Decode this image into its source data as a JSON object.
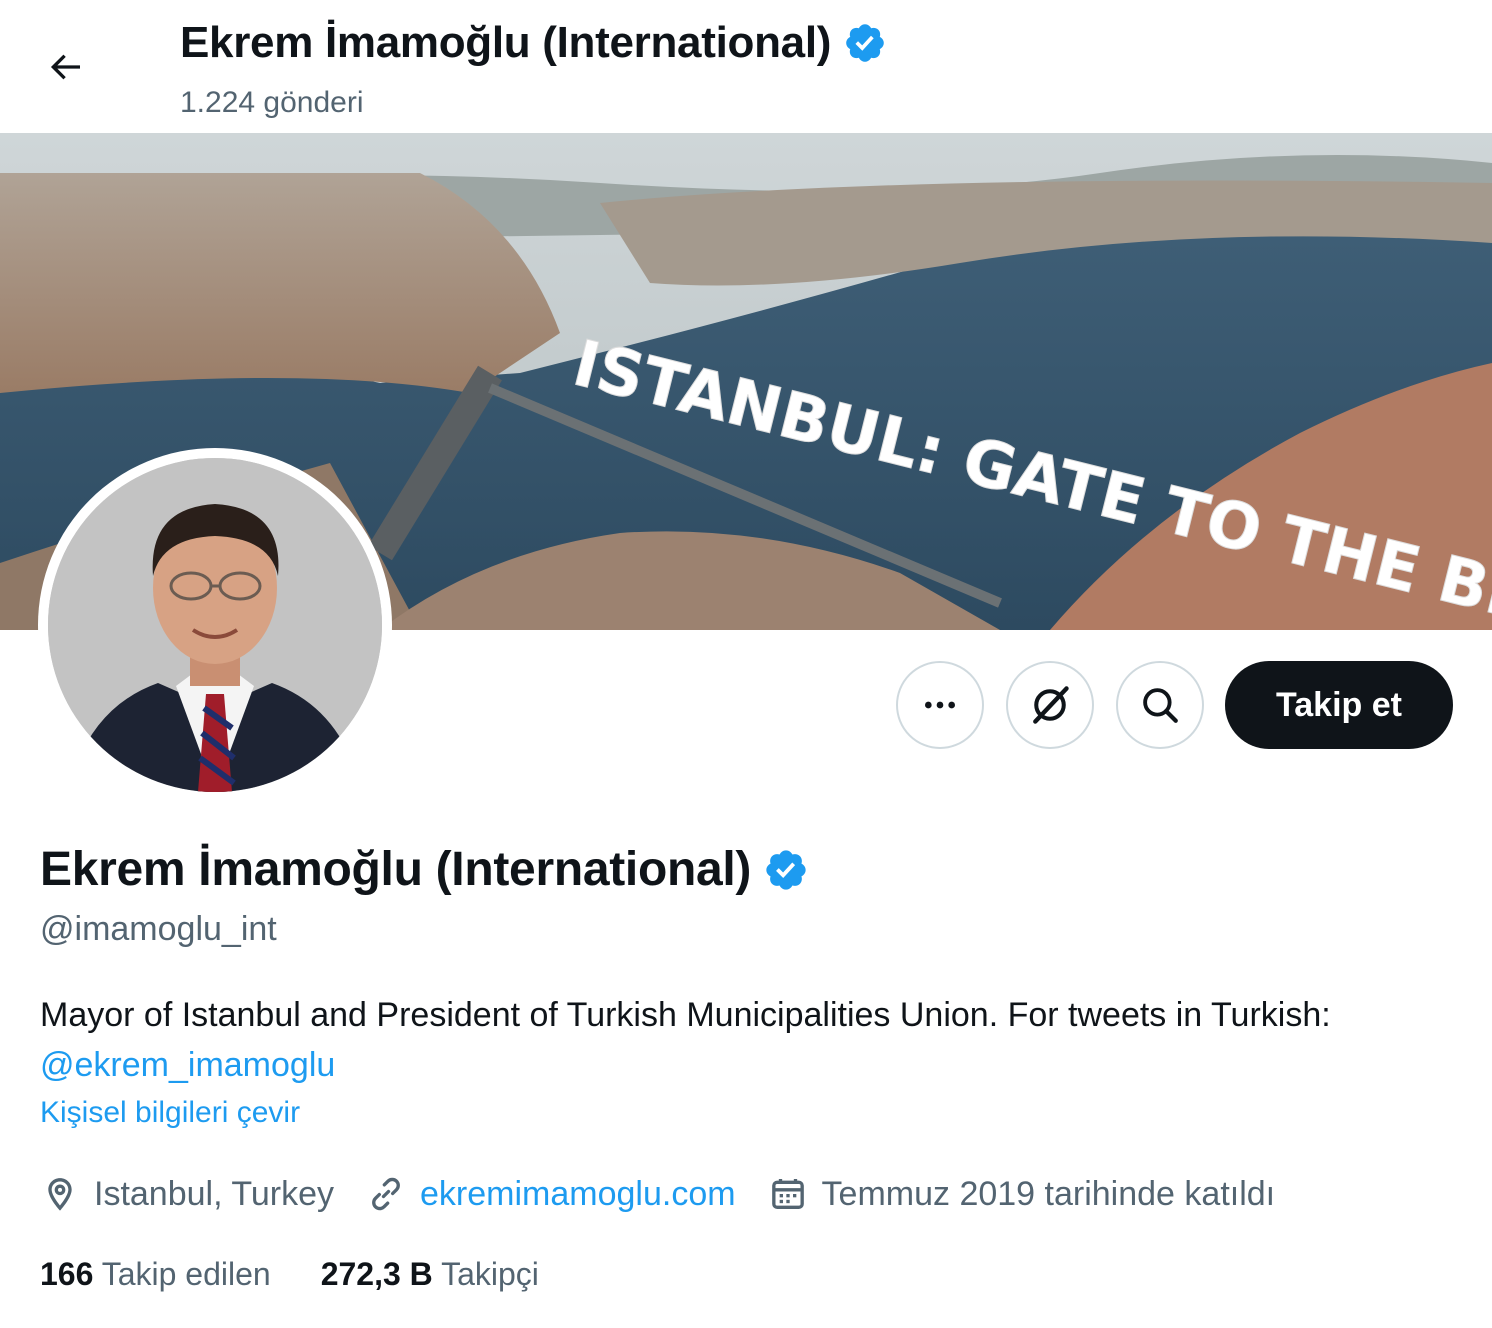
{
  "header": {
    "title": "Ekrem İmamoğlu (International)",
    "post_count": "1.224 gönderi"
  },
  "banner": {
    "text": "ISTANBUL: GATE TO THE BEYOND"
  },
  "actions": {
    "follow_label": "Takip et"
  },
  "profile": {
    "name": "Ekrem İmamoğlu (International)",
    "handle": "@imamoglu_int",
    "bio_text": "Mayor of Istanbul and President of Turkish Municipalities Union. For tweets in Turkish: ",
    "bio_mention": "@ekrem_imamoglu",
    "translate_label": "Kişisel bilgileri çevir",
    "location": "Istanbul, Turkey",
    "website": "ekremimamoglu.com",
    "joined": "Temmuz 2019 tarihinde katıldı",
    "following_count": "166",
    "following_label": "Takip edilen",
    "followers_count": "272,3 B",
    "followers_label": "Takipçi"
  },
  "colors": {
    "accent": "#1d9bf0",
    "text": "#0f1419",
    "muted": "#536471",
    "border": "#cfd9de"
  },
  "icons": [
    "back-arrow-icon",
    "verified-badge-icon",
    "more-icon",
    "grok-icon",
    "search-icon",
    "location-icon",
    "link-icon",
    "calendar-icon"
  ]
}
